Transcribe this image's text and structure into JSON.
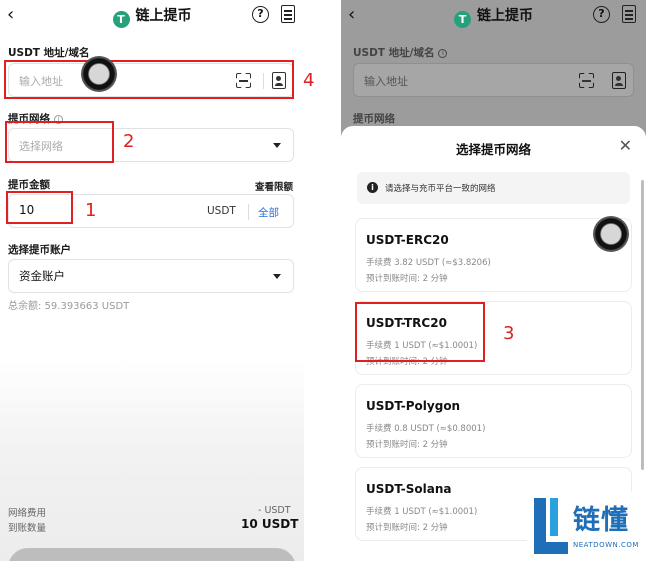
{
  "left": {
    "title": "链上提币",
    "address_label": "USDT 地址/域名",
    "address_placeholder": "输入地址",
    "network_label": "提币网络",
    "network_placeholder": "选择网络",
    "amount_label": "提币金额",
    "view_limits": "查看限额",
    "amount_value": "10",
    "amount_unit": "USDT",
    "all_label": "全部",
    "account_label": "选择提币账户",
    "account_value": "资金账户",
    "total_balance": "总余额: 59.393663 USDT",
    "fee_label": "网络费用",
    "fee_value": "- USDT",
    "receive_label": "到账数量",
    "receive_value": "10 USDT"
  },
  "right": {
    "title": "链上提币",
    "address_label": "USDT 地址/域名",
    "address_placeholder": "输入地址",
    "network_label": "提币网络",
    "sheet_title": "选择提币网络",
    "notice": "请选择与充币平台一致的网络",
    "networks": [
      {
        "name": "USDT-ERC20",
        "fee": "手续费 3.82 USDT (≈$3.8206)",
        "time": "预计到账时间: 2 分钟"
      },
      {
        "name": "USDT-TRC20",
        "fee": "手续费 1 USDT (≈$1.0001)",
        "time": "预计到账时间: 2 分钟"
      },
      {
        "name": "USDT-Polygon",
        "fee": "手续费 0.8 USDT (≈$0.8001)",
        "time": "预计到账时间: 2 分钟"
      },
      {
        "name": "USDT-Solana",
        "fee": "手续费 1 USDT (≈$1.0001)",
        "time": "预计到账时间: 2 分钟"
      }
    ]
  },
  "annotations": [
    "1",
    "2",
    "3",
    "4"
  ],
  "watermark": {
    "brand": "链懂",
    "domain": "NEATDOWN.COM"
  },
  "icons": {
    "logo": "tether-logo-icon",
    "back": "back-chevron-icon",
    "help": "help-circle-icon",
    "records": "document-icon",
    "scan": "scan-icon",
    "contacts": "address-book-icon",
    "dropdown": "caret-down-icon",
    "close": "close-icon",
    "info": "info-icon"
  },
  "colors": {
    "accent_blue": "#2d72d9",
    "tether_green": "#26a17b",
    "annotation_red": "#e02020",
    "brand_blue": "#1f6fb8"
  }
}
